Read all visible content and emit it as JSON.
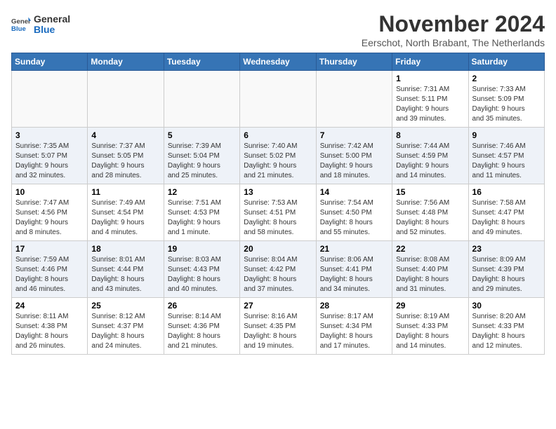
{
  "header": {
    "logo_general": "General",
    "logo_blue": "Blue",
    "month_title": "November 2024",
    "subtitle": "Eerschot, North Brabant, The Netherlands"
  },
  "days_of_week": [
    "Sunday",
    "Monday",
    "Tuesday",
    "Wednesday",
    "Thursday",
    "Friday",
    "Saturday"
  ],
  "weeks": [
    [
      {
        "day": "",
        "info": ""
      },
      {
        "day": "",
        "info": ""
      },
      {
        "day": "",
        "info": ""
      },
      {
        "day": "",
        "info": ""
      },
      {
        "day": "",
        "info": ""
      },
      {
        "day": "1",
        "info": "Sunrise: 7:31 AM\nSunset: 5:11 PM\nDaylight: 9 hours\nand 39 minutes."
      },
      {
        "day": "2",
        "info": "Sunrise: 7:33 AM\nSunset: 5:09 PM\nDaylight: 9 hours\nand 35 minutes."
      }
    ],
    [
      {
        "day": "3",
        "info": "Sunrise: 7:35 AM\nSunset: 5:07 PM\nDaylight: 9 hours\nand 32 minutes."
      },
      {
        "day": "4",
        "info": "Sunrise: 7:37 AM\nSunset: 5:05 PM\nDaylight: 9 hours\nand 28 minutes."
      },
      {
        "day": "5",
        "info": "Sunrise: 7:39 AM\nSunset: 5:04 PM\nDaylight: 9 hours\nand 25 minutes."
      },
      {
        "day": "6",
        "info": "Sunrise: 7:40 AM\nSunset: 5:02 PM\nDaylight: 9 hours\nand 21 minutes."
      },
      {
        "day": "7",
        "info": "Sunrise: 7:42 AM\nSunset: 5:00 PM\nDaylight: 9 hours\nand 18 minutes."
      },
      {
        "day": "8",
        "info": "Sunrise: 7:44 AM\nSunset: 4:59 PM\nDaylight: 9 hours\nand 14 minutes."
      },
      {
        "day": "9",
        "info": "Sunrise: 7:46 AM\nSunset: 4:57 PM\nDaylight: 9 hours\nand 11 minutes."
      }
    ],
    [
      {
        "day": "10",
        "info": "Sunrise: 7:47 AM\nSunset: 4:56 PM\nDaylight: 9 hours\nand 8 minutes."
      },
      {
        "day": "11",
        "info": "Sunrise: 7:49 AM\nSunset: 4:54 PM\nDaylight: 9 hours\nand 4 minutes."
      },
      {
        "day": "12",
        "info": "Sunrise: 7:51 AM\nSunset: 4:53 PM\nDaylight: 9 hours\nand 1 minute."
      },
      {
        "day": "13",
        "info": "Sunrise: 7:53 AM\nSunset: 4:51 PM\nDaylight: 8 hours\nand 58 minutes."
      },
      {
        "day": "14",
        "info": "Sunrise: 7:54 AM\nSunset: 4:50 PM\nDaylight: 8 hours\nand 55 minutes."
      },
      {
        "day": "15",
        "info": "Sunrise: 7:56 AM\nSunset: 4:48 PM\nDaylight: 8 hours\nand 52 minutes."
      },
      {
        "day": "16",
        "info": "Sunrise: 7:58 AM\nSunset: 4:47 PM\nDaylight: 8 hours\nand 49 minutes."
      }
    ],
    [
      {
        "day": "17",
        "info": "Sunrise: 7:59 AM\nSunset: 4:46 PM\nDaylight: 8 hours\nand 46 minutes."
      },
      {
        "day": "18",
        "info": "Sunrise: 8:01 AM\nSunset: 4:44 PM\nDaylight: 8 hours\nand 43 minutes."
      },
      {
        "day": "19",
        "info": "Sunrise: 8:03 AM\nSunset: 4:43 PM\nDaylight: 8 hours\nand 40 minutes."
      },
      {
        "day": "20",
        "info": "Sunrise: 8:04 AM\nSunset: 4:42 PM\nDaylight: 8 hours\nand 37 minutes."
      },
      {
        "day": "21",
        "info": "Sunrise: 8:06 AM\nSunset: 4:41 PM\nDaylight: 8 hours\nand 34 minutes."
      },
      {
        "day": "22",
        "info": "Sunrise: 8:08 AM\nSunset: 4:40 PM\nDaylight: 8 hours\nand 31 minutes."
      },
      {
        "day": "23",
        "info": "Sunrise: 8:09 AM\nSunset: 4:39 PM\nDaylight: 8 hours\nand 29 minutes."
      }
    ],
    [
      {
        "day": "24",
        "info": "Sunrise: 8:11 AM\nSunset: 4:38 PM\nDaylight: 8 hours\nand 26 minutes."
      },
      {
        "day": "25",
        "info": "Sunrise: 8:12 AM\nSunset: 4:37 PM\nDaylight: 8 hours\nand 24 minutes."
      },
      {
        "day": "26",
        "info": "Sunrise: 8:14 AM\nSunset: 4:36 PM\nDaylight: 8 hours\nand 21 minutes."
      },
      {
        "day": "27",
        "info": "Sunrise: 8:16 AM\nSunset: 4:35 PM\nDaylight: 8 hours\nand 19 minutes."
      },
      {
        "day": "28",
        "info": "Sunrise: 8:17 AM\nSunset: 4:34 PM\nDaylight: 8 hours\nand 17 minutes."
      },
      {
        "day": "29",
        "info": "Sunrise: 8:19 AM\nSunset: 4:33 PM\nDaylight: 8 hours\nand 14 minutes."
      },
      {
        "day": "30",
        "info": "Sunrise: 8:20 AM\nSunset: 4:33 PM\nDaylight: 8 hours\nand 12 minutes."
      }
    ]
  ]
}
